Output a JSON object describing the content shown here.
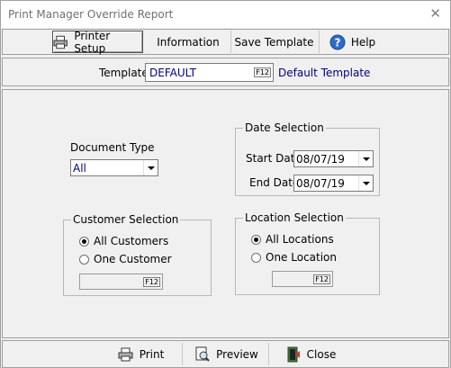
{
  "window": {
    "title": "Print Manager Override Report",
    "close_glyph": "✕"
  },
  "toolbar": {
    "printer_setup": "Printer Setup",
    "information": "Information",
    "save_template": "Save Template",
    "help": "Help"
  },
  "template": {
    "label": "Template",
    "value": "DEFAULT",
    "lookup_key": "F12",
    "description": "Default Template"
  },
  "document_type": {
    "label": "Document Type",
    "value": "All"
  },
  "date_selection": {
    "legend": "Date Selection",
    "start_label": "Start Date",
    "start_value": "08/07/19",
    "end_label": "End Date",
    "end_value": "08/07/19"
  },
  "customer_selection": {
    "legend": "Customer Selection",
    "all_label": "All Customers",
    "one_label": "One Customer",
    "selected": "all",
    "lookup_key": "F12"
  },
  "location_selection": {
    "legend": "Location Selection",
    "all_label": "All Locations",
    "one_label": "One Location",
    "selected": "all",
    "lookup_key": "F12"
  },
  "footer": {
    "print": "Print",
    "preview": "Preview",
    "close": "Close"
  },
  "colors": {
    "value_text": "#000080",
    "background": "#f0f0f0"
  }
}
